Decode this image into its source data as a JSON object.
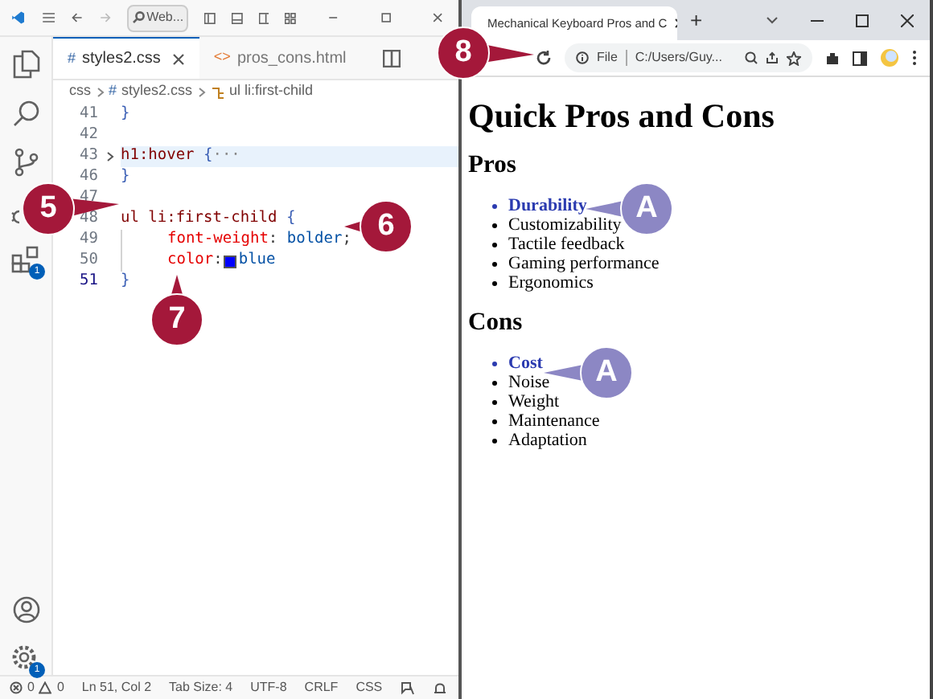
{
  "editor": {
    "title_search": "Web...",
    "tabs": [
      {
        "label": "styles2.css",
        "icon": "#",
        "selected": true
      },
      {
        "label": "pros_cons.html",
        "icon": "<>",
        "selected": false
      }
    ],
    "breadcrumb": [
      "css",
      "styles2.css",
      "ul li:first-child"
    ],
    "lines": [
      {
        "number": "41",
        "current": false,
        "highlighted": false,
        "tokens": [
          {
            "text": "}",
            "kind": "brace"
          }
        ]
      },
      {
        "number": "42",
        "current": false,
        "highlighted": false
      },
      {
        "number": "43",
        "current": false,
        "highlighted": true,
        "folded": true,
        "tokens": [
          {
            "text": "h1:hover ",
            "kind": "selector"
          },
          {
            "text": "{",
            "kind": "brace"
          },
          {
            "text": "···",
            "kind": "fold"
          }
        ]
      },
      {
        "number": "46",
        "current": false,
        "highlighted": false,
        "tokens": [
          {
            "text": "}",
            "kind": "brace"
          }
        ]
      },
      {
        "number": "47",
        "current": false,
        "highlighted": false
      },
      {
        "number": "48",
        "current": false,
        "highlighted": false,
        "tokens": [
          {
            "text": "ul li:first-child ",
            "kind": "selector"
          },
          {
            "text": "{",
            "kind": "brace"
          }
        ]
      },
      {
        "number": "49",
        "current": false,
        "highlighted": false,
        "indented": true,
        "tokens": [
          {
            "text": "font-weight",
            "kind": "property"
          },
          {
            "text": ": ",
            "kind": "punct"
          },
          {
            "text": "bolder",
            "kind": "value"
          },
          {
            "text": ";",
            "kind": "punct"
          }
        ]
      },
      {
        "number": "50",
        "current": false,
        "highlighted": false,
        "indented": true,
        "tokens": [
          {
            "text": "color",
            "kind": "property"
          },
          {
            "text": ":",
            "kind": "punct"
          },
          {
            "kind": "swatch",
            "color": "#0000ff"
          },
          {
            "text": "blue",
            "kind": "value"
          }
        ]
      },
      {
        "number": "51",
        "current": true,
        "highlighted": false,
        "tokens": [
          {
            "text": "}",
            "kind": "brace"
          }
        ]
      }
    ],
    "status_bar": {
      "errors": "0",
      "warnings": "0",
      "items": [
        "Ln 51, Col 2",
        "Tab Size: 4",
        "UTF-8",
        "CRLF",
        "CSS"
      ]
    },
    "badges": {
      "extensions": "1",
      "settings": "1"
    }
  },
  "browser": {
    "tab_title": "Mechanical Keyboard Pros and C",
    "new_tab": "+",
    "address_scheme": "File",
    "address": "C:/Users/Guy...",
    "heading": "Quick Pros and Cons",
    "sections": [
      {
        "title": "Pros",
        "items": [
          {
            "text": "Durability",
            "highlighted": true
          },
          {
            "text": "Customizability",
            "highlighted": false
          },
          {
            "text": "Tactile feedback",
            "highlighted": false
          },
          {
            "text": "Gaming performance",
            "highlighted": false
          },
          {
            "text": "Ergonomics",
            "highlighted": false
          }
        ]
      },
      {
        "title": "Cons",
        "items": [
          {
            "text": "Cost",
            "highlighted": true
          },
          {
            "text": "Noise",
            "highlighted": false
          },
          {
            "text": "Weight",
            "highlighted": false
          },
          {
            "text": "Maintenance",
            "highlighted": false
          },
          {
            "text": "Adaptation",
            "highlighted": false
          }
        ]
      }
    ]
  },
  "callouts": [
    {
      "label": "5",
      "kind": "step"
    },
    {
      "label": "6",
      "kind": "step"
    },
    {
      "label": "7",
      "kind": "step"
    },
    {
      "label": "8",
      "kind": "step"
    },
    {
      "label": "A",
      "kind": "result"
    },
    {
      "label": "A",
      "kind": "result"
    }
  ]
}
